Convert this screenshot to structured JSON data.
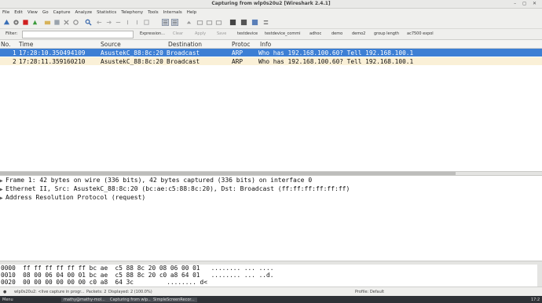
{
  "window": {
    "title": "Capturing from wlp0s20u2 [Wireshark 2.4.1]",
    "controls": "– ◻ ✕"
  },
  "menu": [
    "File",
    "Edit",
    "View",
    "Go",
    "Capture",
    "Analyze",
    "Statistics",
    "Telephony",
    "Tools",
    "Internals",
    "Help"
  ],
  "toolbar": {
    "icons": [
      "shark-fin-start-icon",
      "options-gear-icon",
      "stop-square-icon",
      "restart-icon",
      "open-folder-icon",
      "save-file-icon",
      "close-file-icon",
      "reload-icon",
      "find-icon",
      "back-arrow-icon",
      "forward-arrow-icon",
      "goto-icon",
      "first-icon",
      "last-icon",
      "autoscroll-icon",
      "colorize-icon",
      "zoom-in-icon",
      "zoom-out-icon",
      "normal-size-icon",
      "resize-columns-icon"
    ]
  },
  "filter": {
    "label": "Filter:",
    "value": "",
    "buttons": [
      "Expression...",
      "Clear",
      "Apply",
      "Save"
    ],
    "saved": [
      "testdevice",
      "testdevice_commi",
      "adhoc",
      "demo",
      "demo2",
      "group length",
      "ac7500 expol"
    ]
  },
  "packet_list": {
    "columns": {
      "no": "No.",
      "time": "Time",
      "source": "Source",
      "destination": "Destination",
      "protocol": "Protoc",
      "info": "Info"
    },
    "rows": [
      {
        "no": "1",
        "time": "17:28:10.350494109",
        "source": "AsustekC_88:8c:20",
        "destination": "Broadcast",
        "protocol": "ARP",
        "info": "Who has 192.168.100.60? Tell 192.168.100.1"
      },
      {
        "no": "2",
        "time": "17:28:11.359160210",
        "source": "AsustekC_88:8c:20",
        "destination": "Broadcast",
        "protocol": "ARP",
        "info": "Who has 192.168.100.60? Tell 192.168.100.1"
      }
    ]
  },
  "details": [
    "Frame 1: 42 bytes on wire (336 bits), 42 bytes captured (336 bits) on interface 0",
    "Ethernet II, Src: AsustekC_88:8c:20 (bc:ae:c5:88:8c:20), Dst: Broadcast (ff:ff:ff:ff:ff:ff)",
    "Address Resolution Protocol (request)"
  ],
  "hex": [
    {
      "offset": "0000",
      "bytes": "ff ff ff ff ff ff bc ae  c5 88 8c 20 08 06 00 01",
      "ascii": "........ ... ...."
    },
    {
      "offset": "0010",
      "bytes": "08 00 06 04 00 01 bc ae  c5 88 8c 20 c0 a8 64 01",
      "ascii": "........ ... ..d."
    },
    {
      "offset": "0020",
      "bytes": "00 00 00 00 00 00 c0 a8  64 3c",
      "ascii": "........ d<"
    }
  ],
  "status": {
    "interface": "wlp0s20u2: <live capture in progr...",
    "packets": "Packets: 2",
    "displayed": "Displayed: 2 (100.0%)",
    "profile": "Profile: Default"
  },
  "taskbar": {
    "menu": "Menu",
    "tasks": [
      "mathy@mathy-mol...",
      "Capturing from wlp...",
      "SimpleScreenRecor..."
    ],
    "clock": "17:2"
  },
  "colors": {
    "selected": "#3d7fd4",
    "arp_row": "#faf0d7",
    "stop": "#d02020",
    "shark": "#3a6fb7"
  }
}
